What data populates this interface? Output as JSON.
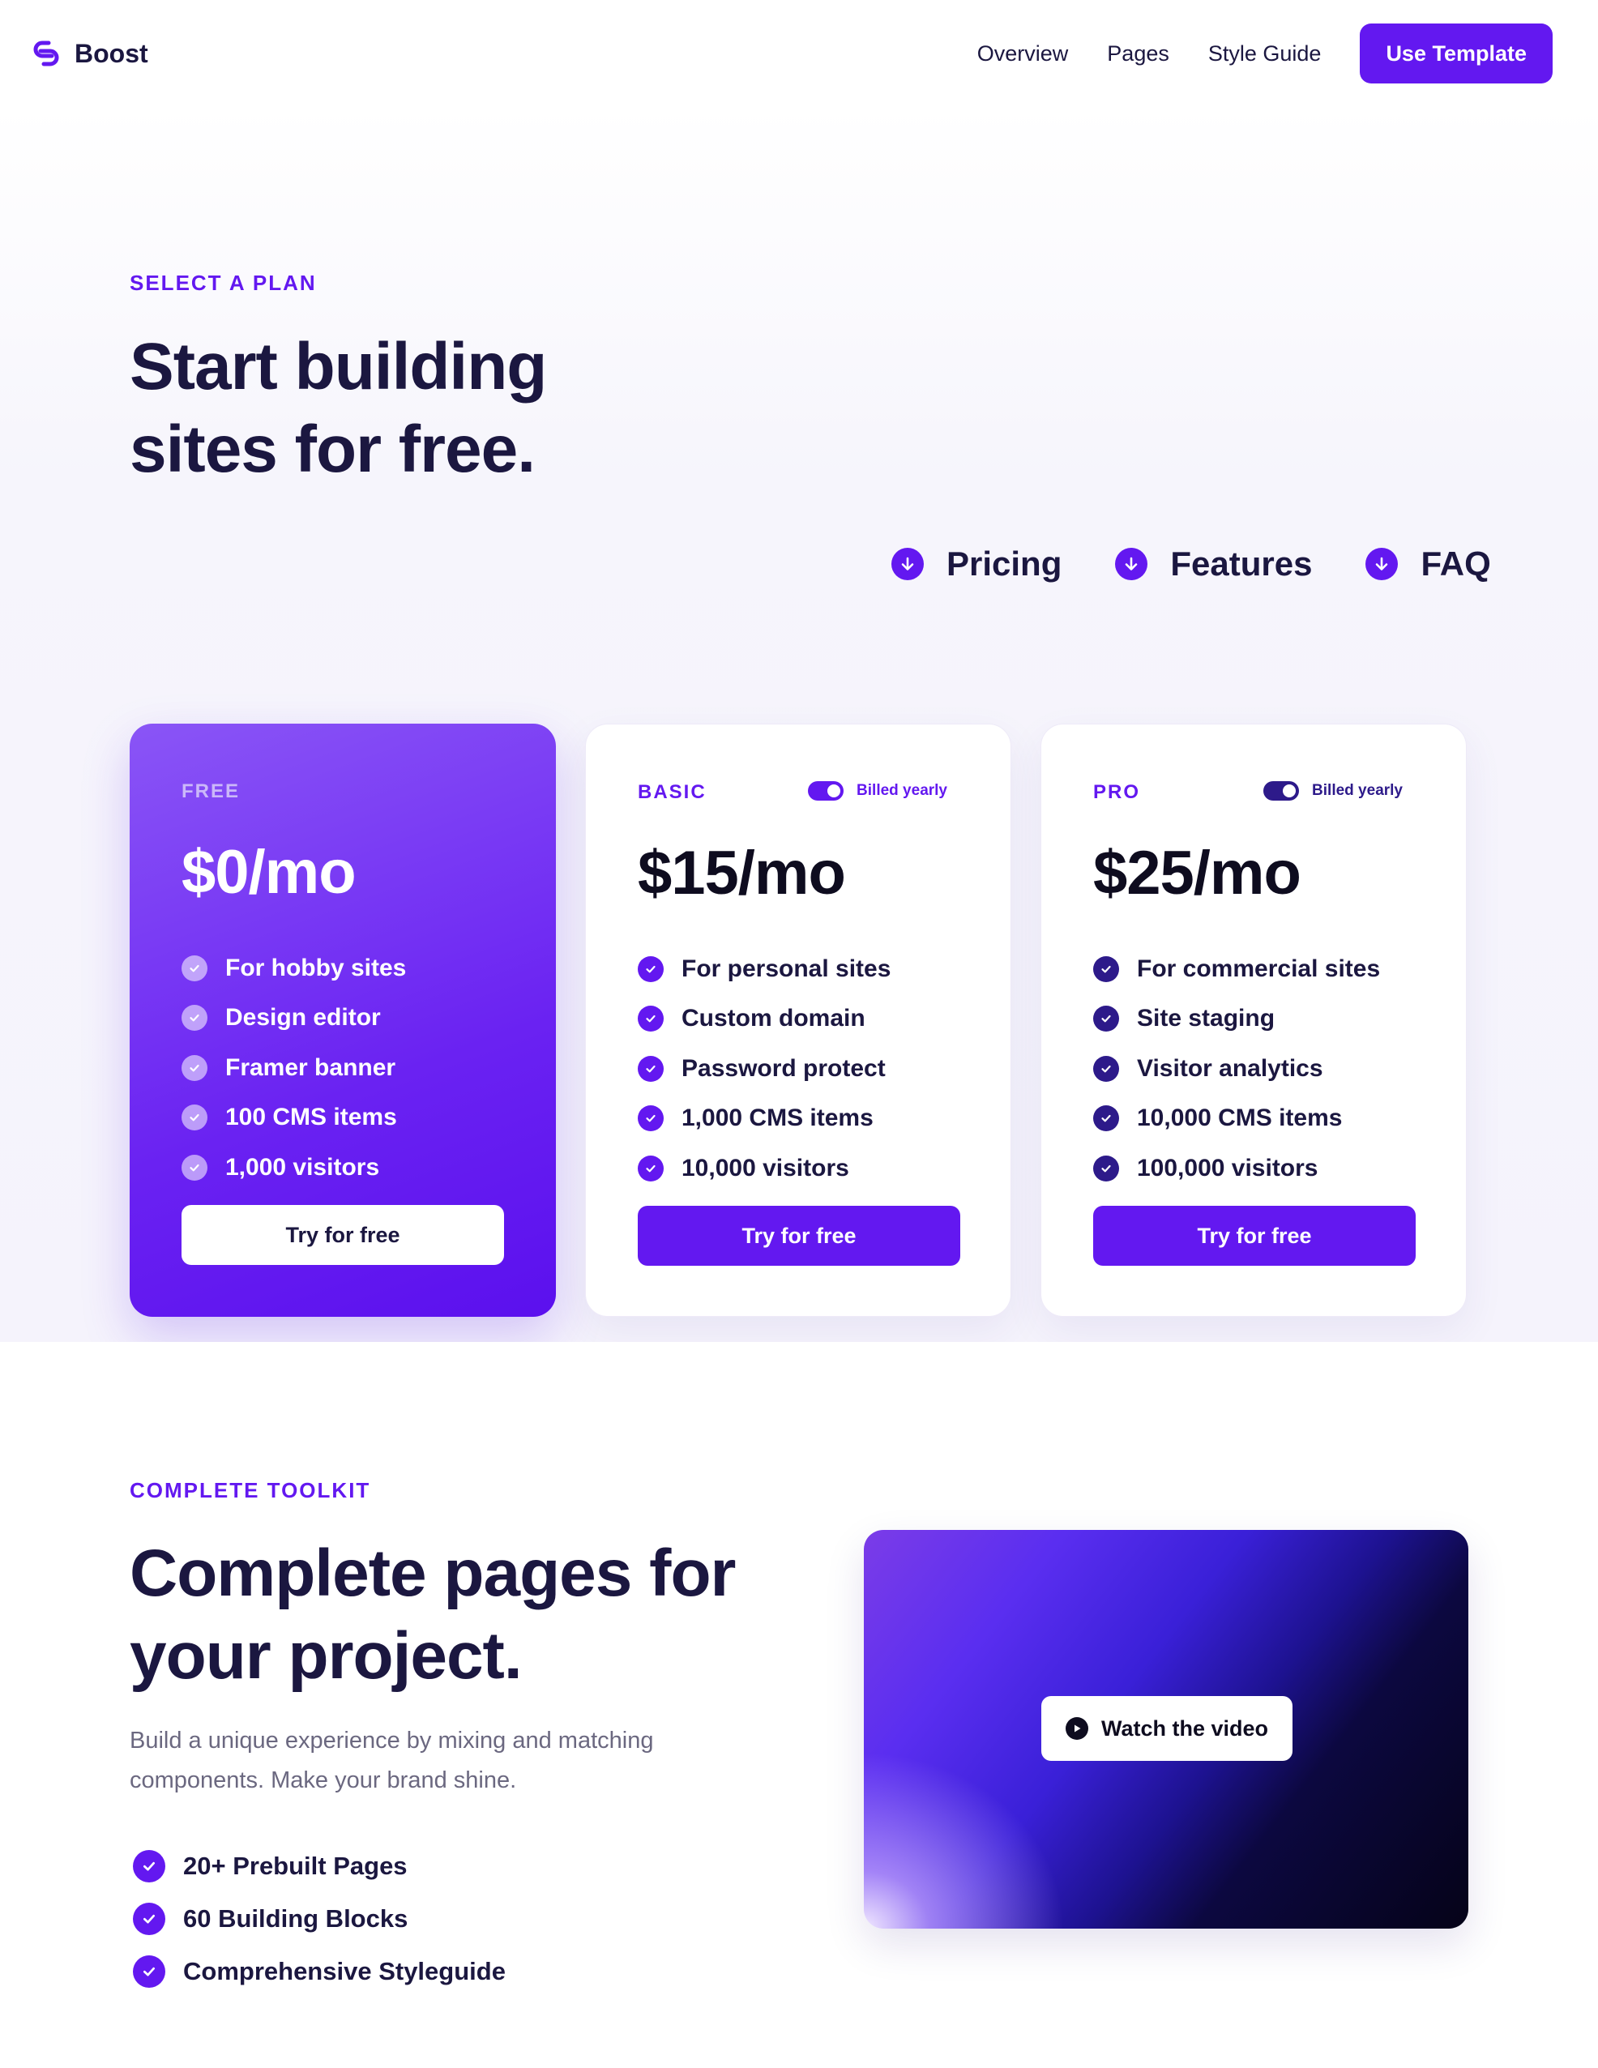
{
  "nav": {
    "brand": "Boost",
    "links": [
      "Overview",
      "Pages",
      "Style Guide"
    ],
    "cta": "Use Template"
  },
  "hero": {
    "eyebrow": "SELECT A PLAN",
    "title": "Start building sites for free.",
    "anchors": [
      "Pricing",
      "Features",
      "FAQ"
    ]
  },
  "plans": [
    {
      "name": "FREE",
      "price": "$0/mo",
      "billing": "",
      "features": [
        "For hobby sites",
        "Design editor",
        "Framer banner",
        "100 CMS items",
        "1,000 visitors"
      ],
      "button": "Try for free"
    },
    {
      "name": "BASIC",
      "price": "$15/mo",
      "billing": "Billed yearly",
      "billing_on": true,
      "features": [
        "For personal sites",
        "Custom domain",
        "Password protect",
        "1,000 CMS items",
        "10,000 visitors"
      ],
      "button": "Try for free"
    },
    {
      "name": "PRO",
      "price": "$25/mo",
      "billing": "Billed yearly",
      "billing_on": true,
      "features": [
        "For commercial sites",
        "Site staging",
        "Visitor analytics",
        "10,000 CMS items",
        "100,000 visitors"
      ],
      "button": "Try for free"
    }
  ],
  "toolkit": {
    "eyebrow": "COMPLETE TOOLKIT",
    "title": "Complete pages for your project.",
    "description": "Build a unique experience by mixing and matching components. Make your brand shine.",
    "items": [
      "20+ Prebuilt Pages",
      "60 Building Blocks",
      "Comprehensive Styleguide"
    ],
    "video_button": "Watch the video"
  },
  "colors": {
    "accent": "#6318f0",
    "dark_accent": "#2d1a8a",
    "text": "#1b1740"
  },
  "icons": {
    "brand": "boost-logo-icon",
    "anchor": "arrow-down-circle-icon",
    "check": "check-circle-icon",
    "play": "play-icon"
  }
}
